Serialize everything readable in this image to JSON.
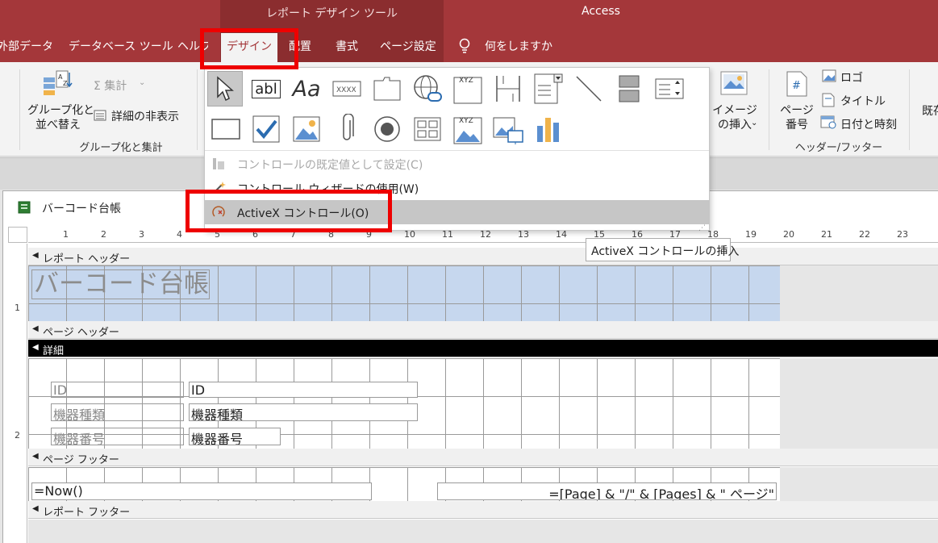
{
  "titlebar": {
    "context_title": "レポート デザイン ツール",
    "app_title": "Access",
    "tabs": [
      {
        "label": "外部データ"
      },
      {
        "label": "データベース ツール"
      },
      {
        "label": "ヘルプ"
      },
      {
        "label": "デザイン"
      },
      {
        "label": "配置"
      },
      {
        "label": "書式"
      },
      {
        "label": "ページ設定"
      }
    ],
    "tell_me": "何をしますか"
  },
  "ribbon": {
    "grouping": {
      "group_sort_label": "グループ化と\n並べ替え",
      "totals_label": "Σ 集計",
      "hide_details_label": "詳細の非表示",
      "group_name": "グループ化と集計"
    },
    "image": {
      "label": "イメージ\nの挿入"
    },
    "header_footer": {
      "page_number_label": "ページ\n番号",
      "logo_label": "ロゴ",
      "title_label": "タイトル",
      "datetime_label": "日付と時刻",
      "group_name": "ヘッダー/フッター"
    },
    "existing_label": "既存"
  },
  "controls_gallery": {
    "text_label_glyph": "Aa",
    "textbox_glyph": "abl",
    "xyz_glyph": "XYZ",
    "menu": {
      "set_default": "コントロールの既定値として設定(C)",
      "wizard": "コントロール ウィザードの使用(W)",
      "activex": "ActiveX コントロール(O)"
    }
  },
  "tooltip": "ActiveX コントロールの挿入",
  "document": {
    "tab_title": "バーコード台帳",
    "ruler_h": [
      "1",
      "2",
      "3",
      "4",
      "5",
      "6",
      "7",
      "8",
      "9",
      "10",
      "11",
      "12",
      "13",
      "14",
      "15",
      "16",
      "17",
      "18",
      "19",
      "20",
      "21",
      "22",
      "23"
    ],
    "ruler_v": [
      "1",
      "2"
    ],
    "sections": {
      "report_header": "レポート ヘッダー",
      "page_header": "ページ ヘッダー",
      "detail": "詳細",
      "page_footer": "ページ フッター",
      "report_footer": "レポート フッター"
    },
    "report_title": "バーコード台帳",
    "fields": [
      {
        "label": "ID",
        "value": "ID"
      },
      {
        "label": "機器種類",
        "value": "機器種類"
      },
      {
        "label": "機器番号",
        "value": "機器番号"
      }
    ],
    "footer_now": "=Now()",
    "footer_pages": "=[Page] & \"/\" & [Pages] & \" ページ\""
  },
  "colors": {
    "accent": "#a4373a",
    "highlight": "#ee0000",
    "section_blue": "#c6d7ee"
  }
}
